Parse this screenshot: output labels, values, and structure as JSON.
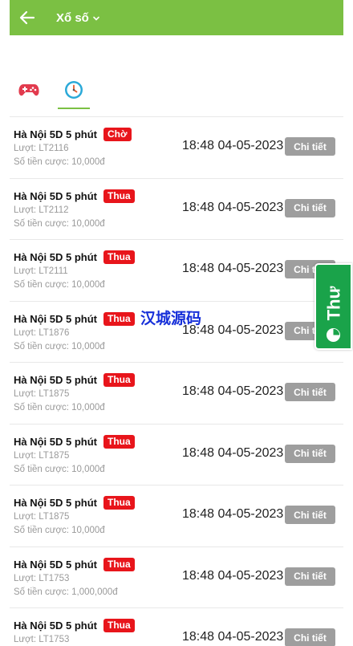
{
  "header": {
    "title": "Xổ số",
    "back_icon": "arrow-left-icon",
    "dropdown_icon": "chevron-down-icon",
    "color": "#7bc043"
  },
  "tabs": [
    {
      "icon": "gamepad-icon",
      "active": false
    },
    {
      "icon": "clock-icon",
      "active": true
    }
  ],
  "records": [
    {
      "title": "Hà Nội 5D 5 phút",
      "status": "Chờ",
      "round": "Lượt: LT2116",
      "amount": "Số tiền cược: 10,000đ",
      "time": "18:48 04-05-2023",
      "button": "Chi tiết"
    },
    {
      "title": "Hà Nội 5D 5 phút",
      "status": "Thua",
      "round": "Lượt: LT2112",
      "amount": "Số tiền cược: 10,000đ",
      "time": "18:48 04-05-2023",
      "button": "Chi tiết"
    },
    {
      "title": "Hà Nội 5D 5 phút",
      "status": "Thua",
      "round": "Lượt: LT2111",
      "amount": "Số tiền cược: 10,000đ",
      "time": "18:48 04-05-2023",
      "button": "Chi tiết"
    },
    {
      "title": "Hà Nội 5D 5 phút",
      "status": "Thua",
      "round": "Lượt: LT1876",
      "amount": "Số tiền cược: 10,000đ",
      "time": "18:48 04-05-2023",
      "button": "Chi tiết"
    },
    {
      "title": "Hà Nội 5D 5 phút",
      "status": "Thua",
      "round": "Lượt: LT1875",
      "amount": "Số tiền cược: 10,000đ",
      "time": "18:48 04-05-2023",
      "button": "Chi tiết"
    },
    {
      "title": "Hà Nội 5D 5 phút",
      "status": "Thua",
      "round": "Lượt: LT1875",
      "amount": "Số tiền cược: 10,000đ",
      "time": "18:48 04-05-2023",
      "button": "Chi tiết"
    },
    {
      "title": "Hà Nội 5D 5 phút",
      "status": "Thua",
      "round": "Lượt: LT1875",
      "amount": "Số tiền cược: 10,000đ",
      "time": "18:48 04-05-2023",
      "button": "Chi tiết"
    },
    {
      "title": "Hà Nội 5D 5 phút",
      "status": "Thua",
      "round": "Lượt: LT1753",
      "amount": "Số tiền cược: 1,000,000đ",
      "time": "18:48 04-05-2023",
      "button": "Chi tiết"
    },
    {
      "title": "Hà Nội 5D 5 phút",
      "status": "Thua",
      "round": "Lượt: LT1753",
      "amount": "",
      "time": "18:48 04-05-2023",
      "button": "Chi tiết"
    }
  ],
  "side_tab": {
    "label": "Thư",
    "icon": "pie-chart-icon",
    "color": "#1aa34a"
  },
  "watermark": "汉城源码",
  "colors": {
    "badge": "#e8151b",
    "detail_button": "#9e9e9e",
    "muted_text": "#9a9a9a"
  }
}
